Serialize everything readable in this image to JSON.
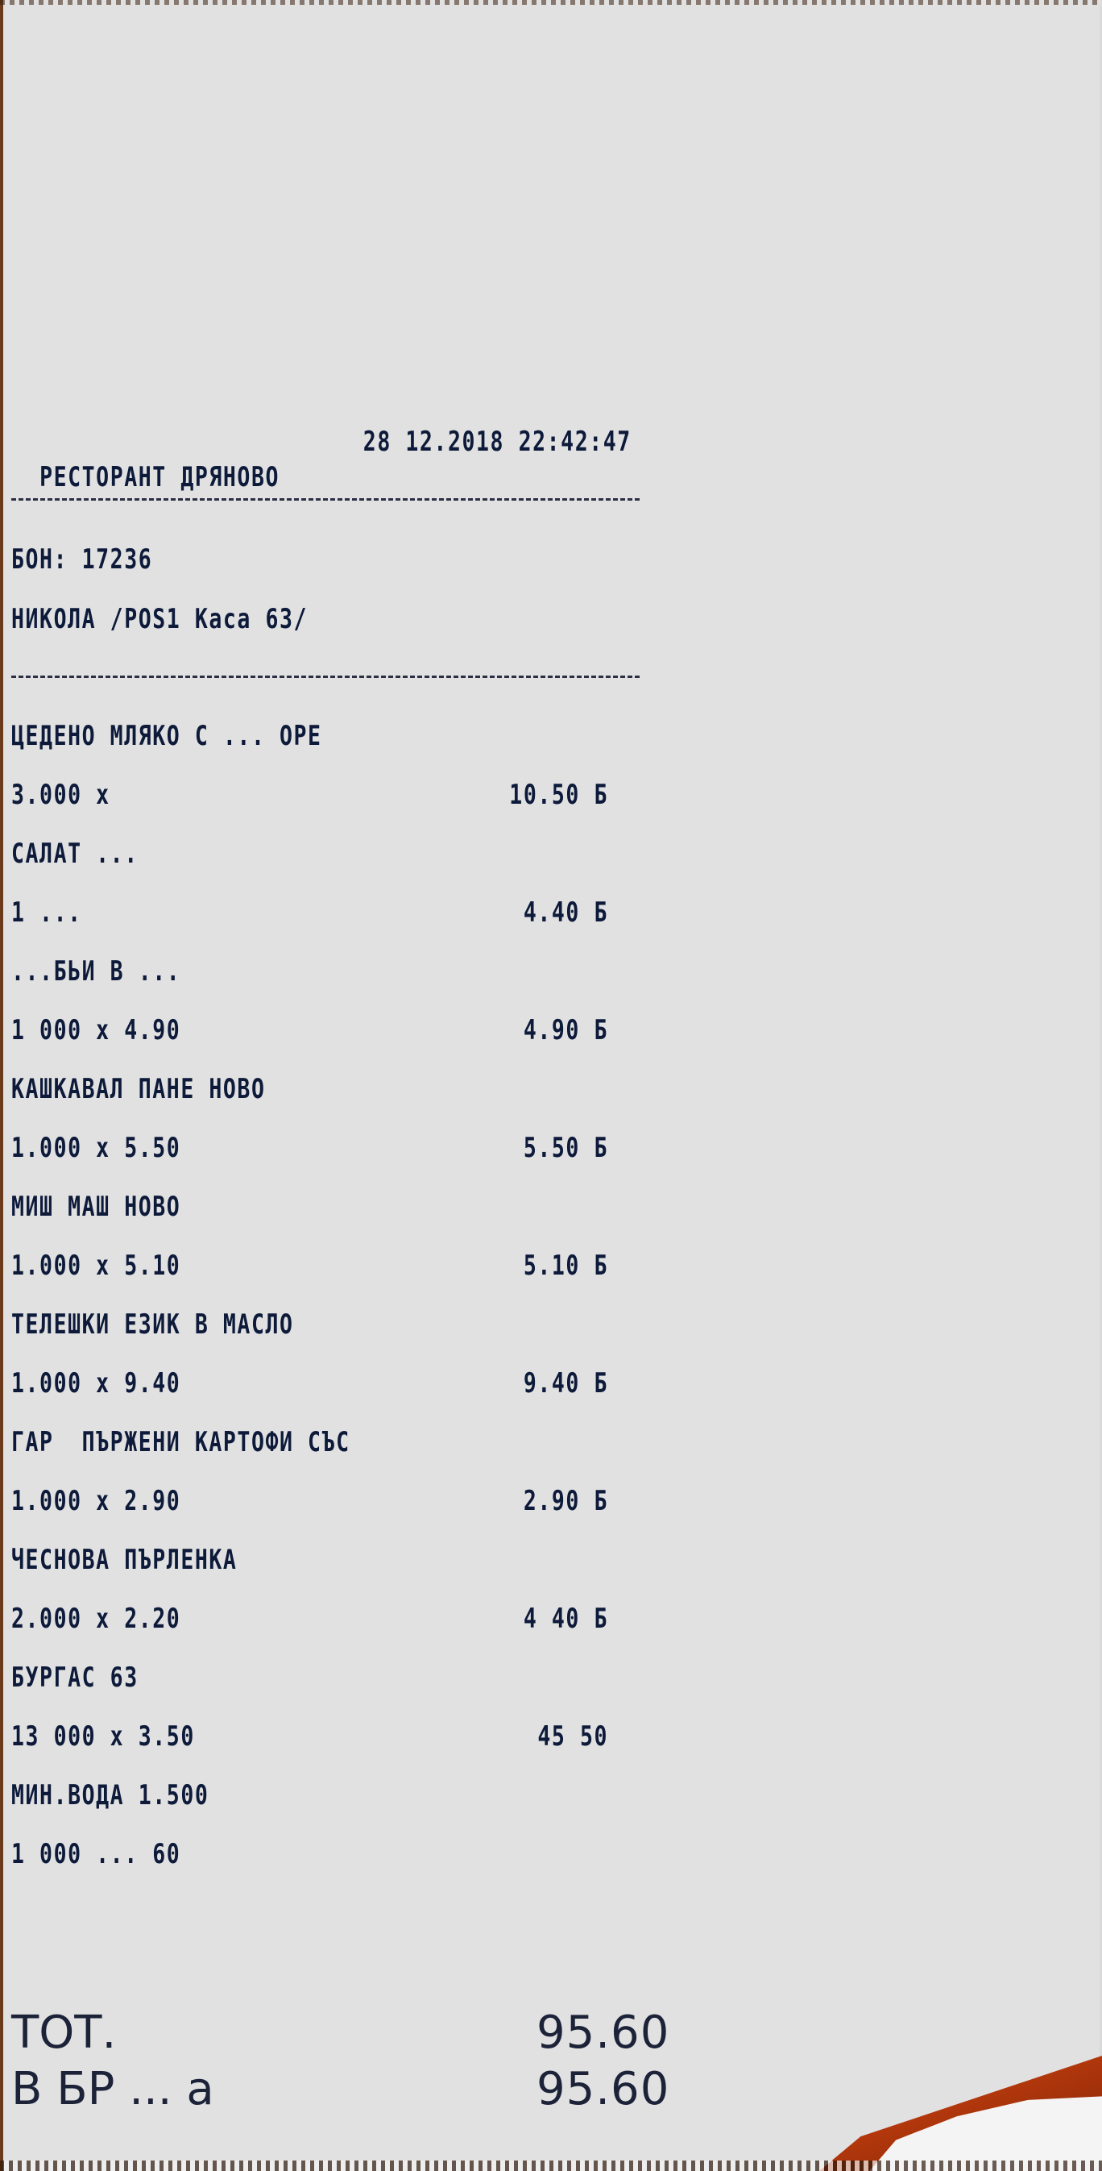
{
  "receipt": {
    "restaurant": "РЕСТОРАНТ ДРЯНОВО",
    "datetime": "28 12.2018 22:42:47",
    "receipt_no": "БОН: 17236",
    "operator": "НИКОЛА /POS1 Каса 63/",
    "items": [
      {
        "name": "ЦЕДЕНО МЛЯКО С ... ОРЕ",
        "qty": "3.000 х",
        "amount": "10.50 Б"
      },
      {
        "name": "САЛАТ ...",
        "qty": "1 ...",
        "amount": "4.40 Б"
      },
      {
        "name": "...БЬИ В ...",
        "qty": "1 000 х 4.90",
        "amount": "4.90 Б"
      },
      {
        "name": "КАШКАВАЛ ПАНЕ НОВО",
        "qty": "1.000 х 5.50",
        "amount": "5.50 Б"
      },
      {
        "name": "МИШ МАШ НОВО",
        "qty": "1.000 х 5.10",
        "amount": "5.10 Б"
      },
      {
        "name": "ТЕЛЕШКИ ЕЗИК В МАСЛО",
        "qty": "1.000 х 9.40",
        "amount": "9.40 Б"
      },
      {
        "name": "ГАР  ПЪРЖЕНИ КАРТОФИ СЪС",
        "qty": "1.000 х 2.90",
        "amount": "2.90 Б"
      },
      {
        "name": "ЧЕСНОВА ПЪРЛЕНКА",
        "qty": "2.000 х 2.20",
        "amount": "4 40 Б"
      },
      {
        "name": "БУРГАС 63",
        "qty": "13 000 х 3.50",
        "amount": "45 50"
      },
      {
        "name": "МИН.ВОДА 1.500",
        "qty": "1 000 ... 60",
        "amount": ""
      }
    ],
    "total_label": "ТОТ.",
    "total_value": "95.60",
    "paid_label": "В БР ... а",
    "paid_value": "95.60"
  }
}
